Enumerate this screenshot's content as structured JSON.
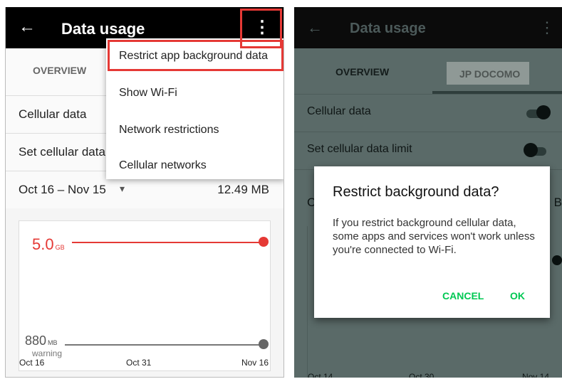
{
  "left": {
    "appbar": {
      "back_icon": "arrow-back-icon",
      "title": "Data usage",
      "menu_icon": "more-vert-icon"
    },
    "tabs": {
      "overview": "OVERVIEW"
    },
    "rows": {
      "cellular_data": "Cellular data",
      "set_limit": "Set cellular data"
    },
    "cycle": {
      "range": "Oct 16 – Nov 15",
      "dropdown_icon": "arrow-drop-down-icon",
      "usage": "12.49 MB"
    },
    "chart": {
      "limit_value": "5.0",
      "limit_unit": "GB",
      "warning_value": "880",
      "warning_unit": "MB",
      "warning_sub": "warning",
      "x_labels": [
        "Oct 16",
        "Oct 31",
        "Nov 16"
      ]
    },
    "overflow_menu": {
      "items": [
        "Restrict app background data",
        "Show Wi-Fi",
        "Network restrictions",
        "Cellular networks"
      ]
    },
    "colors": {
      "limit": "#e53935",
      "highlight": "#e53935"
    }
  },
  "right": {
    "appbar": {
      "back_icon": "arrow-back-icon",
      "title": "Data usage",
      "menu_icon": "more-vert-icon"
    },
    "tabs": {
      "overview": "OVERVIEW",
      "carrier": "JP DOCOMO"
    },
    "rows": {
      "cellular_data": "Cellular data",
      "set_limit": "Set cellular data limit"
    },
    "partial": {
      "left_letter": "C",
      "right_letter": "B"
    },
    "x_labels": [
      "Oct 14",
      "Oct 30",
      "Nov 14"
    ],
    "dialog": {
      "title": "Restrict background data?",
      "body": "If you restrict background cellular data, some apps and services won't work unless you're connected to Wi-Fi.",
      "cancel": "CANCEL",
      "ok": "OK"
    },
    "colors": {
      "dialog_button": "#00c853"
    }
  }
}
